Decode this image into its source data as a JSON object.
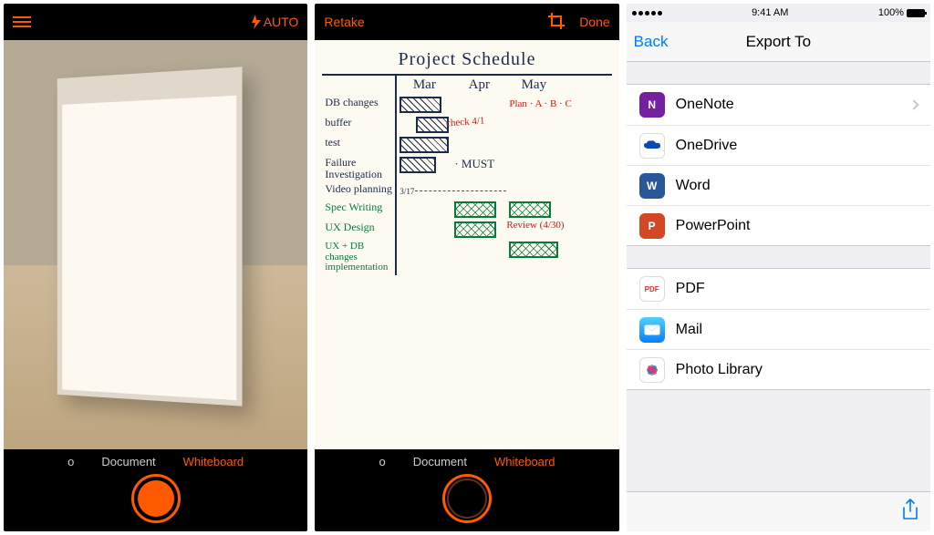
{
  "panel1": {
    "flash_mode": "AUTO",
    "modes": {
      "photo": "o",
      "document": "Document",
      "whiteboard": "Whiteboard"
    }
  },
  "panel2": {
    "retake": "Retake",
    "done": "Done",
    "modes": {
      "photo": "o",
      "document": "Document",
      "whiteboard": "Whiteboard"
    }
  },
  "whiteboard": {
    "title": "Project Schedule",
    "months": [
      "Mar",
      "Apr",
      "May"
    ],
    "rows": [
      "DB changes",
      "buffer",
      "test",
      "Failure Investigation",
      "Video planning",
      "Spec Writing",
      "UX Design",
      "UX + DB changes implementation"
    ],
    "annotations": {
      "check": "check\n4/1",
      "plan": "Plan\n· A\n· B\n· C",
      "must": "· MUST",
      "date": "3/17",
      "review": "Review\n(4/30)"
    }
  },
  "ios": {
    "time": "9:41 AM",
    "battery": "100%",
    "back": "Back",
    "title": "Export To",
    "group1": [
      {
        "label": "OneNote",
        "bg": "#7321a0",
        "glyph": "N",
        "chevron": true
      },
      {
        "label": "OneDrive",
        "bg": "#ffffff",
        "glyph": "cloud"
      },
      {
        "label": "Word",
        "bg": "#2a579a",
        "glyph": "W"
      },
      {
        "label": "PowerPoint",
        "bg": "#d24726",
        "glyph": "P"
      }
    ],
    "group2": [
      {
        "label": "PDF",
        "bg": "#ffffff",
        "glyph": "pdf"
      },
      {
        "label": "Mail",
        "bg": "#1eaefc",
        "glyph": "mail"
      },
      {
        "label": "Photo Library",
        "bg": "#ffffff",
        "glyph": "flower"
      }
    ]
  }
}
